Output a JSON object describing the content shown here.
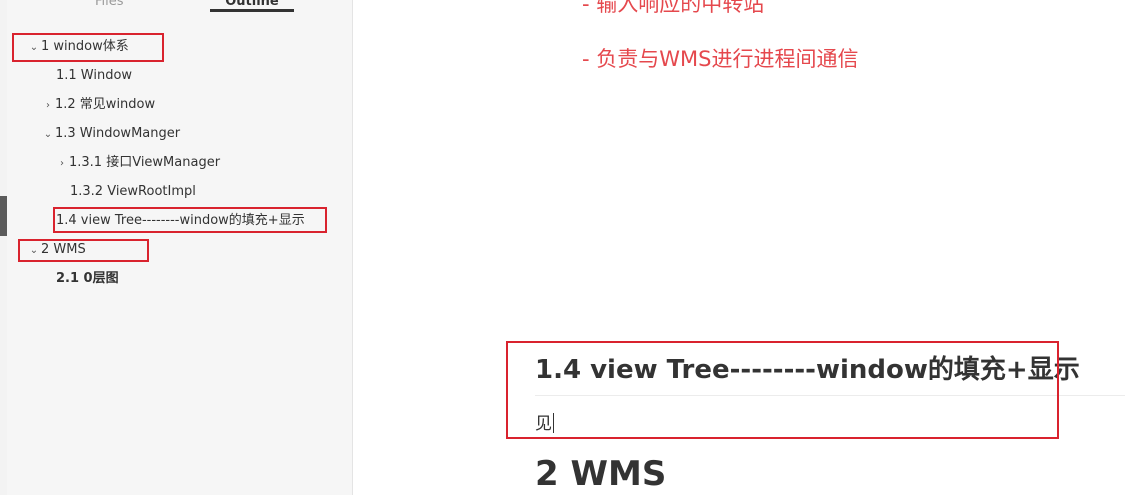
{
  "sidebar": {
    "tabs": {
      "files": "Files",
      "outline": "Outline"
    },
    "outline": [
      {
        "label": "1 window体系",
        "expanded": true
      },
      {
        "label": "1.1 Window"
      },
      {
        "label": "1.2 常见window",
        "expanded": false
      },
      {
        "label": "1.3 WindowManger",
        "expanded": true
      },
      {
        "label": "1.3.1 接口ViewManager",
        "expanded": false
      },
      {
        "label": "1.3.2 ViewRootImpl"
      },
      {
        "label": "1.4 view Tree--------window的填充+显示"
      },
      {
        "label": "2 WMS",
        "expanded": true
      },
      {
        "label": "2.1 0层图",
        "active": true
      }
    ]
  },
  "content": {
    "top_partial_line": "- 输入响应的中转站",
    "red_line": "- 负责与WMS进行进程间通信",
    "heading_1_4": "1.4 view Tree--------window的填充+显示",
    "paragraph": "见",
    "heading_2": "2 WMS"
  },
  "colors": {
    "highlight_box": "#d9232e",
    "red_text": "#e5484d"
  }
}
